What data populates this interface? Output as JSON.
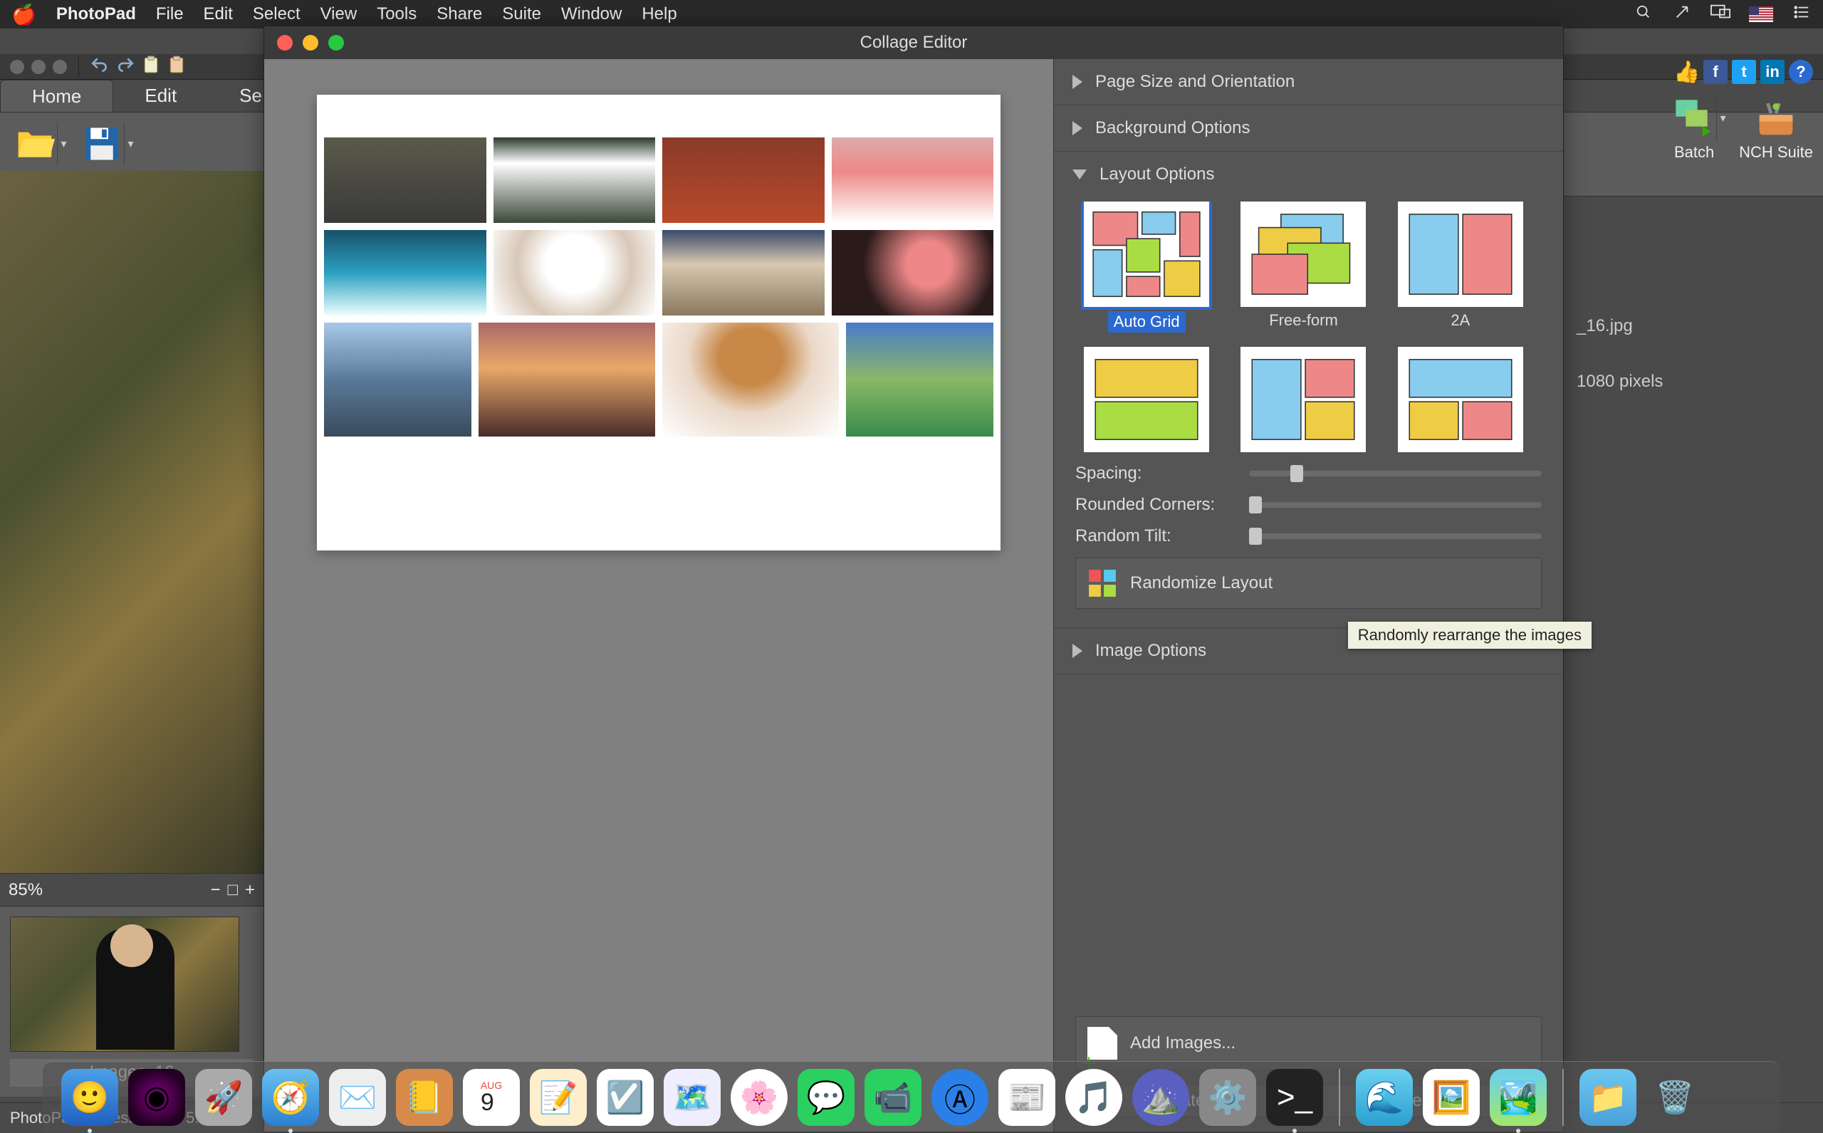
{
  "menubar": {
    "app": "PhotoPad",
    "items": [
      "File",
      "Edit",
      "Select",
      "View",
      "Tools",
      "Share",
      "Suite",
      "Window",
      "Help"
    ]
  },
  "tabs": {
    "home": "Home",
    "edit": "Edit",
    "se": "Se"
  },
  "ribbon": {
    "open": "Open",
    "save": "Save",
    "batch": "Batch",
    "nch": "NCH Suite"
  },
  "thumb": {
    "name": "Images_16"
  },
  "zoom": {
    "pct": "85%"
  },
  "status": {
    "text": "PhotoPad Professional v 5.22 ©"
  },
  "info": {
    "file": "_16.jpg",
    "dims": "1080 pixels"
  },
  "modal": {
    "title": "Collage Editor",
    "sect_page": "Page Size and Orientation",
    "sect_bg": "Background Options",
    "sect_layout": "Layout Options",
    "sect_image": "Image Options",
    "opts": [
      "Auto Grid",
      "Free-form",
      "2A"
    ],
    "spacing": "Spacing:",
    "corners": "Rounded Corners:",
    "tilt": "Random Tilt:",
    "randomize": "Randomize Layout",
    "tooltip": "Randomly rearrange the images",
    "add": "Add Images...",
    "create": "Create",
    "cancel": "Cancel"
  },
  "social_help": "?"
}
